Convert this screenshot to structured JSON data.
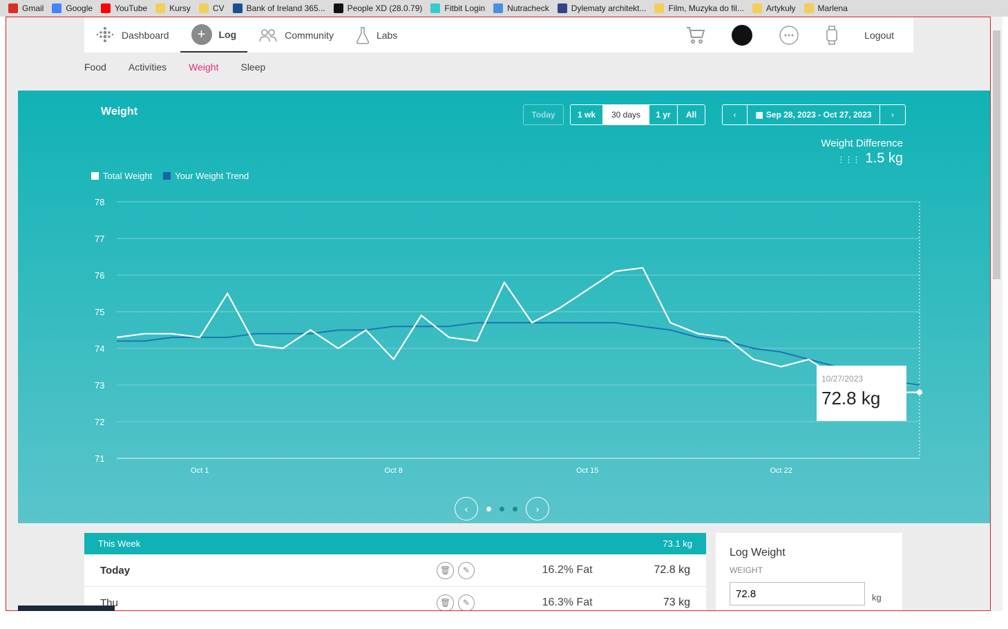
{
  "bookmarks": [
    {
      "label": "Gmail",
      "icon": "gmail-icon",
      "color": "#d93025"
    },
    {
      "label": "Google",
      "icon": "google-icon",
      "color": "#4285f4"
    },
    {
      "label": "YouTube",
      "icon": "youtube-icon",
      "color": "#ff0000"
    },
    {
      "label": "Kursy",
      "icon": "folder-icon",
      "color": "#f2cf5b"
    },
    {
      "label": "CV",
      "icon": "folder-icon",
      "color": "#f2cf5b"
    },
    {
      "label": "Bank of Ireland 365...",
      "icon": "bank-icon",
      "color": "#1f4e8c"
    },
    {
      "label": "People XD (28.0.79)",
      "icon": "x-icon",
      "color": "#111111"
    },
    {
      "label": "Fitbit Login",
      "icon": "fitbit-icon",
      "color": "#3cc"
    },
    {
      "label": "Nutracheck",
      "icon": "nutracheck-icon",
      "color": "#4a90e2"
    },
    {
      "label": "Dylematy architekt...",
      "icon": "site-icon",
      "color": "#334488"
    },
    {
      "label": "Film, Muzyka do fil...",
      "icon": "folder-icon",
      "color": "#f2cf5b"
    },
    {
      "label": "Artykuły",
      "icon": "folder-icon",
      "color": "#f2cf5b"
    },
    {
      "label": "Marlena",
      "icon": "folder-icon",
      "color": "#f2cf5b"
    }
  ],
  "nav": {
    "dashboard": "Dashboard",
    "log": "Log",
    "community": "Community",
    "labs": "Labs",
    "logout": "Logout"
  },
  "subnav": {
    "food": "Food",
    "activities": "Activities",
    "weight": "Weight",
    "sleep": "Sleep"
  },
  "hero": {
    "title": "Weight",
    "today": "Today",
    "ranges": [
      "1 wk",
      "30 days",
      "1 yr",
      "All"
    ],
    "selected_range": "30 days",
    "date_range": "Sep 28, 2023 - Oct 27, 2023",
    "weight_diff_label": "Weight Difference",
    "weight_diff_value": "1.5 kg",
    "tooltip_date": "10/27/2023",
    "tooltip_value": "72.8 kg"
  },
  "chart_data": {
    "type": "line",
    "y_ticks": [
      "78",
      "77",
      "76",
      "75",
      "74",
      "73",
      "72",
      "71"
    ],
    "ylim": [
      71,
      78
    ],
    "x_ticks": [
      "Oct 1",
      "Oct 8",
      "Oct 15",
      "Oct 22"
    ],
    "x_tick_days": [
      4,
      11,
      18,
      25
    ],
    "xlim": [
      1,
      30
    ],
    "legend": [
      "Total Weight",
      "Your Weight Trend"
    ],
    "colors": {
      "total": "#ffffff",
      "trend": "#1976b4"
    },
    "series": [
      {
        "name": "Total Weight",
        "x": [
          1,
          2,
          3,
          4,
          5,
          6,
          7,
          8,
          9,
          10,
          11,
          12,
          13,
          14,
          15,
          16,
          17,
          18,
          19,
          20,
          21,
          22,
          23,
          24,
          25,
          26,
          27,
          28,
          29,
          30
        ],
        "values": [
          74.3,
          74.4,
          74.4,
          74.3,
          75.5,
          74.1,
          74.0,
          74.5,
          74.0,
          74.5,
          73.7,
          74.9,
          74.3,
          74.2,
          75.8,
          74.7,
          75.1,
          75.6,
          76.1,
          76.2,
          74.7,
          74.4,
          74.3,
          73.7,
          73.5,
          73.7,
          73.2,
          72.9,
          72.8,
          72.8
        ]
      },
      {
        "name": "Your Weight Trend",
        "x": [
          1,
          2,
          3,
          4,
          5,
          6,
          7,
          8,
          9,
          10,
          11,
          12,
          13,
          14,
          15,
          16,
          17,
          18,
          19,
          20,
          21,
          22,
          23,
          24,
          25,
          26,
          27,
          28,
          29,
          30
        ],
        "values": [
          74.2,
          74.2,
          74.3,
          74.3,
          74.3,
          74.4,
          74.4,
          74.4,
          74.5,
          74.5,
          74.6,
          74.6,
          74.6,
          74.7,
          74.7,
          74.7,
          74.7,
          74.7,
          74.7,
          74.6,
          74.5,
          74.3,
          74.2,
          74.0,
          73.9,
          73.7,
          73.5,
          73.3,
          73.1,
          73.0
        ]
      }
    ]
  },
  "week": {
    "title": "This Week",
    "total": "73.1 kg",
    "rows": [
      {
        "day": "Today",
        "fat": "16.2% Fat",
        "kg": "72.8 kg"
      },
      {
        "day": "Thu",
        "fat": "16.3% Fat",
        "kg": "73 kg"
      }
    ]
  },
  "log_weight": {
    "title": "Log Weight",
    "caption": "WEIGHT",
    "value": "72.8",
    "unit": "kg"
  }
}
